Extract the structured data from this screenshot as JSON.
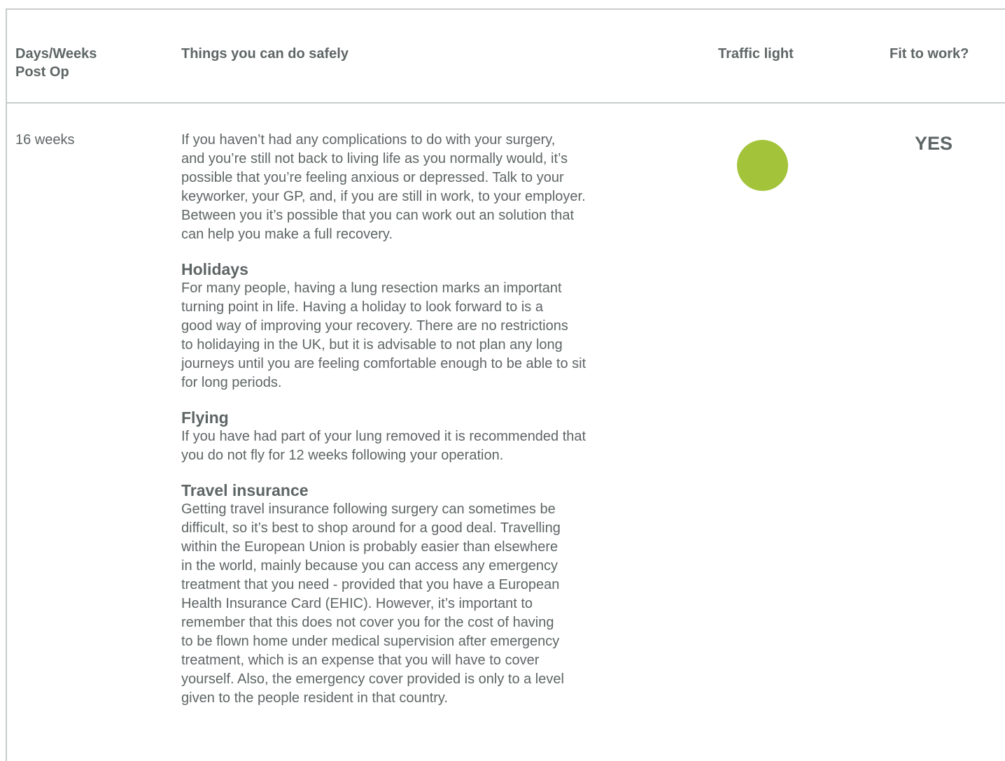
{
  "table": {
    "headers": {
      "days": "Days/Weeks\nPost Op",
      "things": "Things you can do safely",
      "traffic": "Traffic light",
      "fit": "Fit to work?"
    },
    "row": {
      "days": "16 weeks",
      "intro": "If you haven’t had any complications to do with your surgery,\nand you’re still not back to living life as you normally would, it’s\npossible that you’re feeling anxious or depressed. Talk to your\nkeyworker, your GP, and, if you are still in work, to your employer.\nBetween you it’s possible that you can work out an solution that\ncan help you make a full recovery.",
      "sections": [
        {
          "heading": "Holidays",
          "text": "For many people, having a lung resection marks an important\nturning point in life. Having a holiday to look forward to is a\ngood way of improving your recovery. There are no restrictions\nto holidaying in the UK, but it is advisable to not plan any long\njourneys until you are feeling comfortable enough to be able to sit\nfor long periods."
        },
        {
          "heading": "Flying",
          "text": "If you have had part of your lung removed it is recommended that\nyou do not fly for 12 weeks following your operation."
        },
        {
          "heading": "Travel insurance",
          "text": "Getting travel insurance following surgery can sometimes be\ndifficult, so it’s best to shop around for a good deal. Travelling\nwithin the European Union is probably easier than elsewhere\nin the world, mainly because you can access any emergency\ntreatment that you need - provided that you have a European\nHealth Insurance Card (EHIC). However, it’s important to\nremember that this does not cover you for the cost of having\nto be flown home under medical supervision after emergency\ntreatment, which is an expense that you will have to cover\nyourself. Also, the emergency cover provided is only to a level\ngiven to the people resident in that country."
        }
      ],
      "traffic_light_color": "#a3c43a",
      "fit_to_work": "YES"
    }
  },
  "colors": {
    "text": "#5e6565",
    "border": "#c9cccc",
    "green_light": "#a3c43a"
  }
}
